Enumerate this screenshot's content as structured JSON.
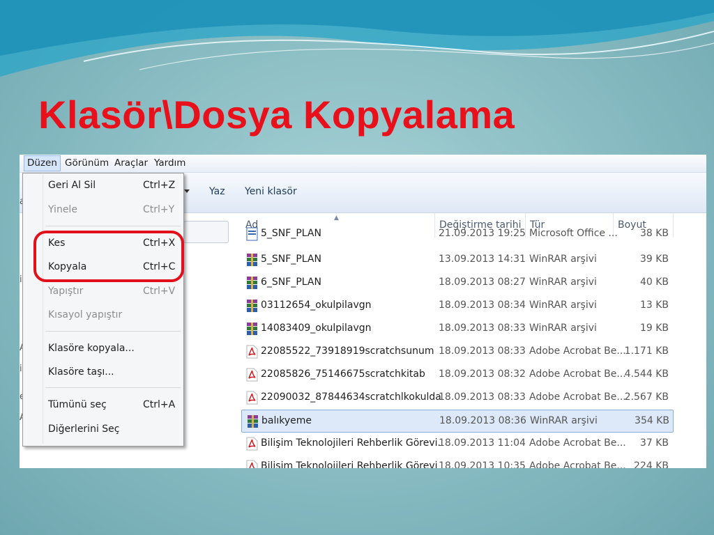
{
  "slide": {
    "title": "Klasör\\Dosya Kopyalama"
  },
  "menubar": {
    "items": [
      "Düzen",
      "Görünüm",
      "Araçlar",
      "Yardım"
    ]
  },
  "toolbar": {
    "write_label": "Yaz",
    "new_folder_label": "Yeni klasör"
  },
  "left_fragments": [
    "a",
    "i",
    "A",
    "i",
    "e",
    "A"
  ],
  "edit_menu": {
    "items": [
      {
        "label": "Geri Al Sil",
        "shortcut": "Ctrl+Z",
        "enabled": true
      },
      {
        "label": "Yinele",
        "shortcut": "Ctrl+Y",
        "enabled": false
      },
      {
        "label": "Kes",
        "shortcut": "Ctrl+X",
        "enabled": true
      },
      {
        "label": "Kopyala",
        "shortcut": "Ctrl+C",
        "enabled": true
      },
      {
        "label": "Yapıştır",
        "shortcut": "Ctrl+V",
        "enabled": false
      },
      {
        "label": "Kısayol yapıştır",
        "shortcut": "",
        "enabled": false
      },
      {
        "label": "Klasöre kopyala...",
        "shortcut": "",
        "enabled": true
      },
      {
        "label": "Klasöre taşı...",
        "shortcut": "",
        "enabled": true
      },
      {
        "label": "Tümünü seç",
        "shortcut": "Ctrl+A",
        "enabled": true
      },
      {
        "label": "Diğerlerini Seç",
        "shortcut": "",
        "enabled": true
      }
    ]
  },
  "file_list": {
    "columns": [
      "Ad",
      "Değiştirme tarihi",
      "Tür",
      "Boyut"
    ],
    "rows": [
      {
        "name": "5_SNF_PLAN",
        "date": "21.09.2013 19:25",
        "type": "Microsoft Office ...",
        "size": "38 KB",
        "icon": "word-doc-icon"
      },
      {
        "name": "5_SNF_PLAN",
        "date": "13.09.2013 14:31",
        "type": "WinRAR arşivi",
        "size": "39 KB",
        "icon": "winrar-archive-icon"
      },
      {
        "name": "6_SNF_PLAN",
        "date": "18.09.2013 08:27",
        "type": "WinRAR arşivi",
        "size": "40 KB",
        "icon": "winrar-archive-icon"
      },
      {
        "name": "03112654_okulpilavgn",
        "date": "18.09.2013 08:34",
        "type": "WinRAR arşivi",
        "size": "13 KB",
        "icon": "winrar-archive-icon"
      },
      {
        "name": "14083409_okulpilavgn",
        "date": "18.09.2013 08:33",
        "type": "WinRAR arşivi",
        "size": "19 KB",
        "icon": "winrar-archive-icon"
      },
      {
        "name": "22085522_73918919scratchsunum",
        "date": "18.09.2013 08:33",
        "type": "Adobe Acrobat Be...",
        "size": "1.171 KB",
        "icon": "pdf-icon"
      },
      {
        "name": "22085826_75146675scratchkitab",
        "date": "18.09.2013 08:32",
        "type": "Adobe Acrobat Be...",
        "size": "4.544 KB",
        "icon": "pdf-icon"
      },
      {
        "name": "22090032_87844634scratchlkokulda",
        "date": "18.09.2013 08:33",
        "type": "Adobe Acrobat Be...",
        "size": "2.567 KB",
        "icon": "pdf-icon"
      },
      {
        "name": "balıkyeme",
        "date": "18.09.2013 08:36",
        "type": "WinRAR arşivi",
        "size": "354 KB",
        "icon": "winrar-archive-icon",
        "selected": true
      },
      {
        "name": "Bilişim Teknolojileri Rehberlik Görevi.",
        "date": "18.09.2013 11:04",
        "type": "Adobe Acrobat Be...",
        "size": "37 KB",
        "icon": "pdf-icon"
      },
      {
        "name": "Bilişim Teknolojileri Rehberlik Görevi",
        "date": "18.09.2013 10:35",
        "type": "Adobe Acrobat Be...",
        "size": "224 KB",
        "icon": "pdf-icon"
      }
    ]
  },
  "colors": {
    "title_red": "#e8101a",
    "highlight_ring": "#e3101c",
    "selection_bg": "#dde9f8"
  }
}
